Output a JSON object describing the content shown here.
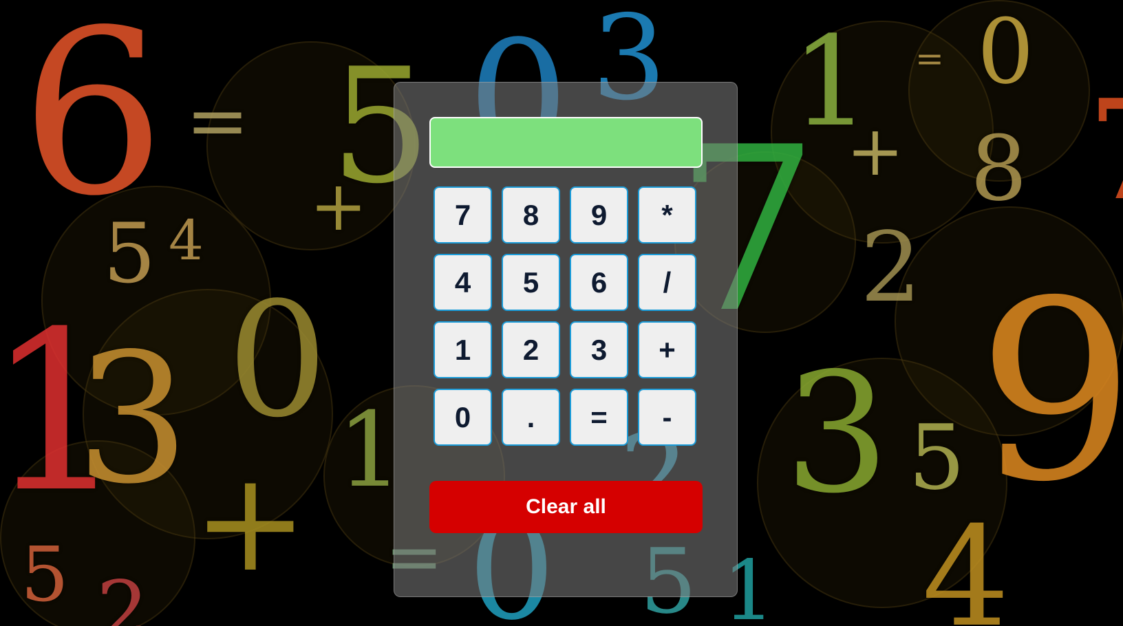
{
  "display": {
    "value": ""
  },
  "keypad": {
    "keys": [
      {
        "label": "7",
        "name": "key-7"
      },
      {
        "label": "8",
        "name": "key-8"
      },
      {
        "label": "9",
        "name": "key-9"
      },
      {
        "label": "*",
        "name": "key-multiply"
      },
      {
        "label": "4",
        "name": "key-4"
      },
      {
        "label": "5",
        "name": "key-5"
      },
      {
        "label": "6",
        "name": "key-6"
      },
      {
        "label": "/",
        "name": "key-divide"
      },
      {
        "label": "1",
        "name": "key-1"
      },
      {
        "label": "2",
        "name": "key-2"
      },
      {
        "label": "3",
        "name": "key-3"
      },
      {
        "label": "+",
        "name": "key-plus"
      },
      {
        "label": "0",
        "name": "key-0"
      },
      {
        "label": ".",
        "name": "key-decimal"
      },
      {
        "label": "=",
        "name": "key-equals"
      },
      {
        "label": "-",
        "name": "key-minus"
      }
    ]
  },
  "clear": {
    "label": "Clear all"
  },
  "colors": {
    "display_bg": "#7de07d",
    "key_bg": "#efefef",
    "key_border": "#1a9bd8",
    "key_text": "#0e1a30",
    "clear_bg": "#d50000",
    "clear_text": "#ffffff",
    "page_bg": "#000000"
  }
}
